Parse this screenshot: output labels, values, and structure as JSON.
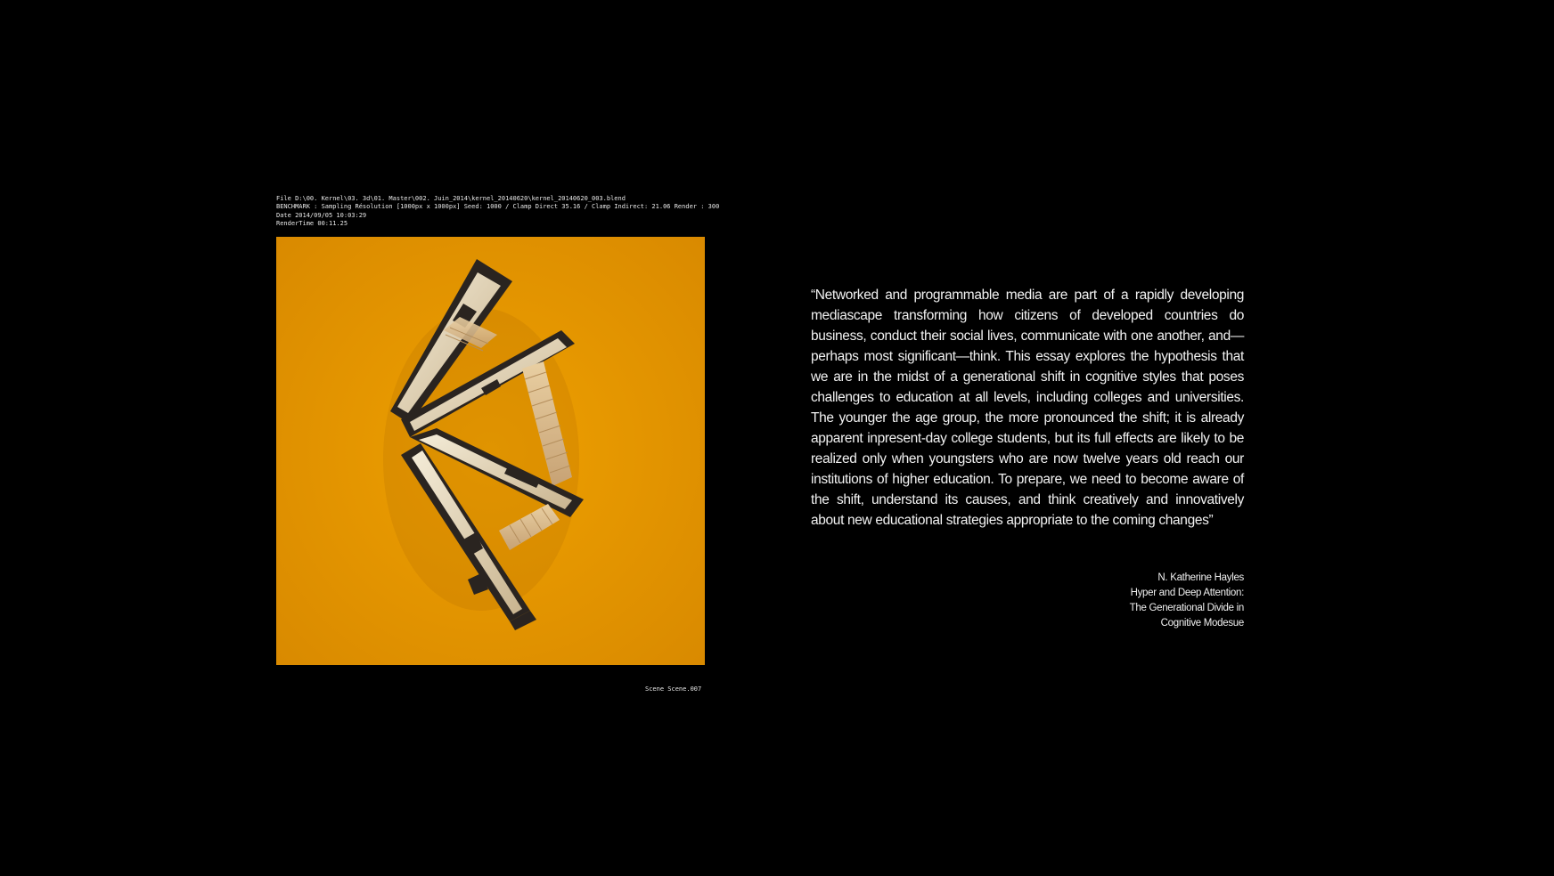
{
  "render_info": {
    "lines": [
      "File D:\\00. Kernel\\03. 3d\\01. Master\\002. Juin_2014\\kernel_20140620\\kernel_20140620_003.blend",
      "BENCHMARK : Sampling Résolution [1000px x 1000px] Seed: 1000 / Clamp Direct 35.16 / Clamp Indirect: 21.06 Render : 300",
      "Date 2014/09/05 10:03:29",
      "RenderTime 00:11.25"
    ],
    "scene_label": "Scene Scene.007"
  },
  "image": {
    "background_color": "#df9000",
    "subject": "three triangular model pieces viewed from above"
  },
  "quote": {
    "text": "“Networked and programmable media are part of a rapidly developing mediascape transforming how citizens of developed countries do business, conduct their social lives, communicate with one another, and—perhaps most significant—think. This essay explores the hypothesis that we are in the midst of a generational shift in cognitive styles that poses challenges to education at all levels, including colleges and universities. The younger the age group, the more pronounced the shift; it is already apparent inpresent-day college students, but its full effects are likely to be realized only when youngsters who are now twelve years old reach our institutions of higher education. To prepare, we need to become aware of the shift, understand its causes, and think creatively and innovatively about new educational strategies appropriate to the coming changes”"
  },
  "attribution": {
    "author": "N. Katherine Hayles",
    "title_lines": [
      "Hyper and Deep Attention:",
      "The Generational Divide in",
      "Cognitive Modesue"
    ]
  }
}
